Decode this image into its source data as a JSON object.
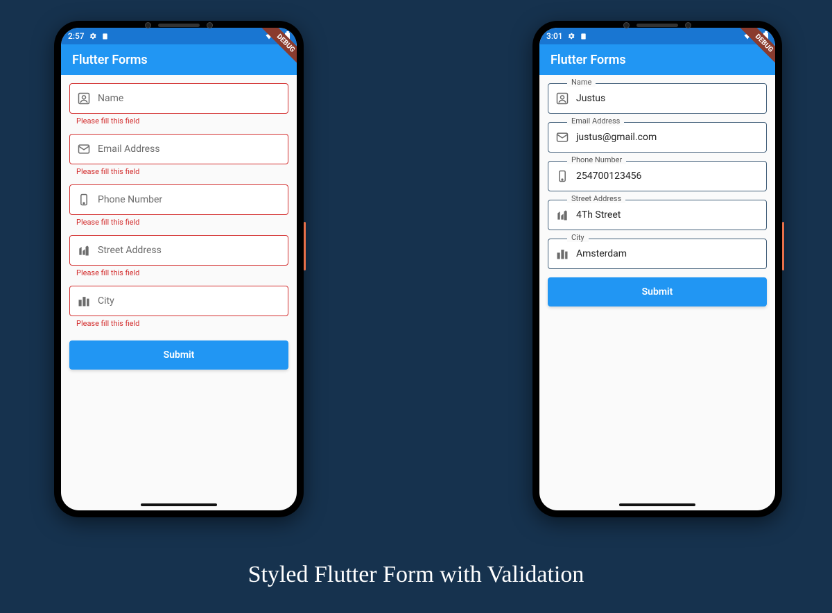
{
  "caption": "Styled Flutter Form with Validation",
  "debug_label": "DEBUG",
  "phones": {
    "left": {
      "time": "2:57",
      "title": "Flutter Forms",
      "error_message": "Please fill this field",
      "submit_label": "Submit",
      "fields": {
        "name": {
          "placeholder": "Name"
        },
        "email": {
          "placeholder": "Email Address"
        },
        "phone": {
          "placeholder": "Phone Number"
        },
        "street": {
          "placeholder": "Street Address"
        },
        "city": {
          "placeholder": "City"
        }
      }
    },
    "right": {
      "time": "3:01",
      "title": "Flutter Forms",
      "submit_label": "Submit",
      "fields": {
        "name": {
          "label": "Name",
          "value": "Justus"
        },
        "email": {
          "label": "Email Address",
          "value": "justus@gmail.com"
        },
        "phone": {
          "label": "Phone Number",
          "value": "254700123456"
        },
        "street": {
          "label": "Street Address",
          "value": "4Th Street"
        },
        "city": {
          "label": "City",
          "value": "Amsterdam"
        }
      }
    }
  }
}
